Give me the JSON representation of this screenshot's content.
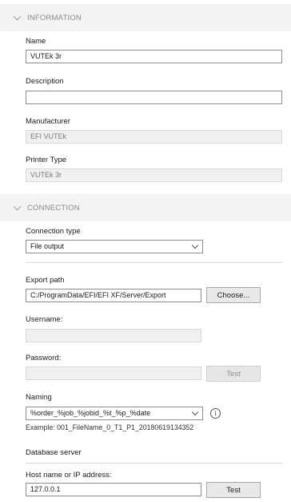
{
  "information": {
    "header": "INFORMATION",
    "name_label": "Name",
    "name_value": "VUTEk 3r",
    "description_label": "Description",
    "description_value": "",
    "manufacturer_label": "Manufacturer",
    "manufacturer_value": "EFI VUTEk",
    "printer_type_label": "Printer Type",
    "printer_type_value": "VUTEk 3r"
  },
  "connection": {
    "header": "CONNECTION",
    "type_label": "Connection type",
    "type_value": "File output",
    "export_label": "Export path",
    "export_value": "C:/ProgramData/EFI/EFI XF/Server/Export",
    "choose_label": "Choose...",
    "username_label": "Username:",
    "username_value": "",
    "password_label": "Password:",
    "password_value": "",
    "test_label": "Test",
    "naming_label": "Naming",
    "naming_value": "%order_%job_%jobid_%t_%p_%date",
    "info_glyph": "i",
    "example_text": "Example: 001_FileName_0_T1_P1_20180619134352",
    "db_label": "Database server",
    "host_label": "Host name or IP address:",
    "host_value": "127.0.0.1",
    "host_test_label": "Test"
  },
  "icons": {
    "collapse": "chevron-down-icon",
    "dropdown": "chevron-down-icon",
    "info": "info-icon"
  },
  "colors": {
    "header_bg": "#f3f3f3",
    "header_text": "#8a8a8a",
    "field_border": "#8c8c8c",
    "disabled_bg": "#f0f0f0"
  }
}
